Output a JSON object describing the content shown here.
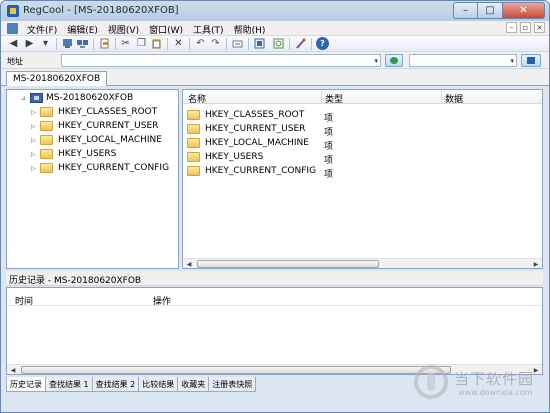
{
  "window": {
    "title": "RegCool - [MS-20180620XFOB]"
  },
  "window_controls": {
    "minimize": "–",
    "maximize": "□",
    "close": "✕"
  },
  "menu": {
    "items": [
      "文件(F)",
      "编辑(E)",
      "视图(V)",
      "窗口(W)",
      "工具(T)",
      "帮助(H)"
    ]
  },
  "mdi_controls": {
    "minimize": "–",
    "restore": "▫",
    "close": "×"
  },
  "toolbar": {
    "buttons": [
      "back",
      "forward",
      "dropdown",
      "computer",
      "network",
      "export",
      "cut",
      "copy",
      "paste",
      "delete",
      "undo",
      "redo",
      "edit",
      "compare",
      "refresh",
      "wand",
      "help"
    ],
    "glyphs": {
      "back": "◀",
      "forward": "▶",
      "dropdown": "▾",
      "cut": "✂",
      "copy": "❐",
      "paste": "📋",
      "delete": "✕",
      "undo": "↶",
      "redo": "↷",
      "help": "?"
    }
  },
  "address": {
    "label": "地址",
    "value": "",
    "dropdown_glyph": "▾"
  },
  "search": {
    "value": "",
    "dropdown_glyph": "▾"
  },
  "doc_tab": {
    "label": "MS-20180620XFOB"
  },
  "tree": {
    "expander_open": "⊿",
    "expander_closed": "▷",
    "root": "MS-20180620XFOB",
    "items": [
      "HKEY_CLASSES_ROOT",
      "HKEY_CURRENT_USER",
      "HKEY_LOCAL_MACHINE",
      "HKEY_USERS",
      "HKEY_CURRENT_CONFIG"
    ]
  },
  "list": {
    "columns": {
      "name": "名称",
      "type": "类型",
      "data": "数据"
    },
    "rows": [
      {
        "name": "HKEY_CLASSES_ROOT",
        "type": "项"
      },
      {
        "name": "HKEY_CURRENT_USER",
        "type": "项"
      },
      {
        "name": "HKEY_LOCAL_MACHINE",
        "type": "项"
      },
      {
        "name": "HKEY_USERS",
        "type": "项"
      },
      {
        "name": "HKEY_CURRENT_CONFIG",
        "type": "项"
      }
    ]
  },
  "scroll": {
    "left": "◀",
    "right": "▶",
    "grip": "⦙"
  },
  "history": {
    "title": "历史记录 - MS-20180620XFOB",
    "columns": {
      "time": "时间",
      "action": "操作"
    }
  },
  "bottom_tabs": [
    "历史记录",
    "查找结果 1",
    "查找结果 2",
    "比较结果",
    "收藏夹",
    "注册表快照"
  ],
  "watermark": {
    "text": "当下软件园",
    "url": "www.downxia.com"
  },
  "colors": {
    "title_bar": "#b9cbe3",
    "accent": "#1f62b4",
    "folder": "#f1c457"
  }
}
